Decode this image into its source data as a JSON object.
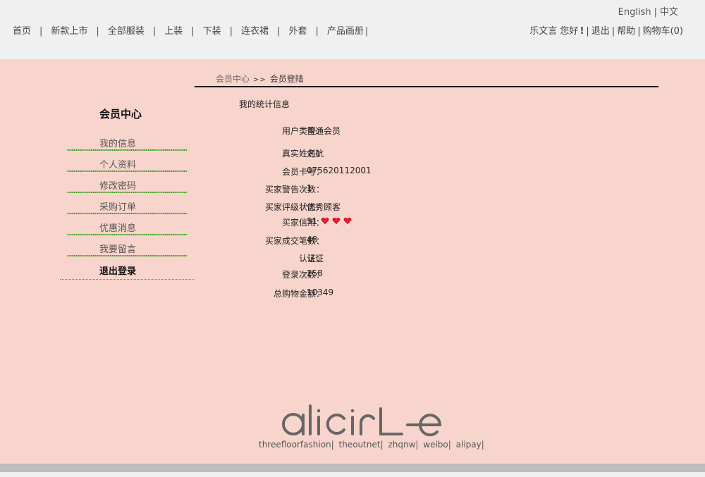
{
  "lang": {
    "english": "English",
    "sep": "|",
    "chinese": "中文"
  },
  "nav": {
    "items": [
      "首页",
      "新款上市",
      "全部服装",
      "上装",
      "下装",
      "连衣裙",
      "外套",
      "产品画册"
    ],
    "sep": "|"
  },
  "user": {
    "name": "乐文言",
    "greeting": "您好",
    "bang": "!",
    "logout": "退出",
    "help": "帮助",
    "cart": "购物车(0)",
    "sep": "|"
  },
  "breadcrumb": {
    "parent": "会员中心",
    "arrow": ">>",
    "current": "会员登陆"
  },
  "sidebar": {
    "title": "会员中心",
    "items": [
      {
        "label": "我的信息"
      },
      {
        "label": "个人资料"
      },
      {
        "label": "修改密码"
      },
      {
        "label": "采购订单"
      },
      {
        "label": "优惠消息"
      },
      {
        "label": "我要留言"
      }
    ],
    "logout": "退出登录"
  },
  "stats": {
    "title": "我的统计信息",
    "rows": [
      {
        "key": "用户类型：",
        "value": "普通会员"
      },
      {
        "key": "真实姓名：",
        "value": "刘航"
      },
      {
        "key": "会员卡号：",
        "value": "075620112001"
      },
      {
        "key": "买家警告次数：",
        "value": "1"
      },
      {
        "key": "买家评级状态：",
        "value": "优秀顾客"
      },
      {
        "key": "买家信用：",
        "value": "51",
        "hearts": 3
      },
      {
        "key": "买家成交笔数：",
        "value": "48"
      },
      {
        "key": "认证：",
        "value": "认证"
      },
      {
        "key": "登录次数：",
        "value": "258"
      },
      {
        "key": "总购物金额：",
        "value": "10349"
      }
    ]
  },
  "footer": {
    "logo_text": "alicirle",
    "links": [
      "threefloorfashion",
      "theoutnet",
      "zhqnw",
      "weibo",
      "alipay"
    ],
    "sep": "|"
  },
  "colors": {
    "page_bg": "#f8d5cc",
    "header_bg": "#f0f0f0",
    "divider": "#111111",
    "sidebar_dots": "#3d9a1e",
    "heart": "#e0202a",
    "logo": "#666666",
    "bottom_bar": "#bdbdbd"
  }
}
